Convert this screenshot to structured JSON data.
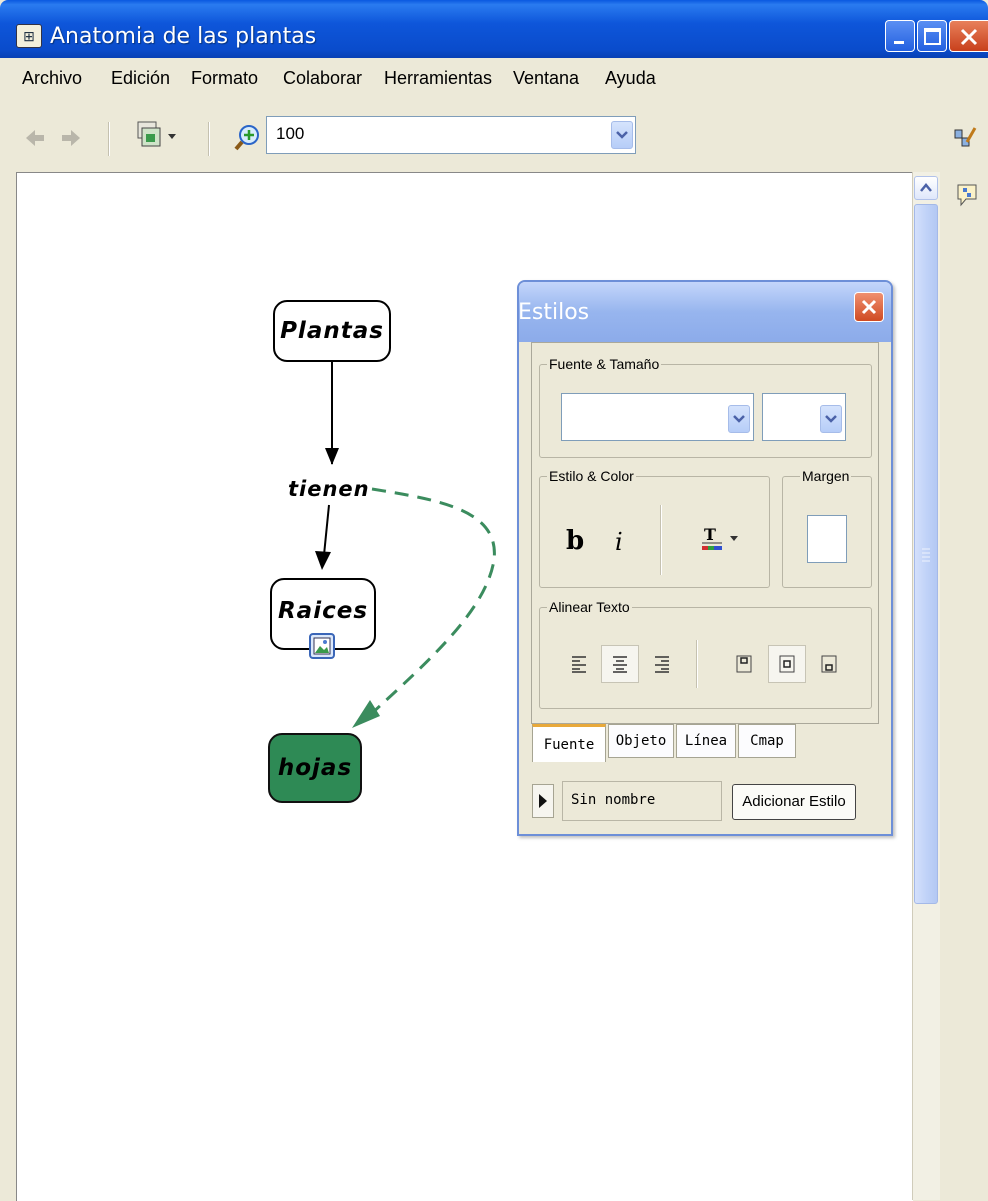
{
  "window": {
    "title": "Anatomia de las plantas"
  },
  "menu": [
    "Archivo",
    "Edición",
    "Formato",
    "Colaborar",
    "Herramientas",
    "Ventana",
    "Ayuda"
  ],
  "toolbar": {
    "zoom_value": "100"
  },
  "concept_map": {
    "nodes": {
      "plantas": "Plantas",
      "raices": "Raices",
      "hojas": "hojas"
    },
    "linking_phrase": "tienen",
    "colors": {
      "hojas_fill": "#2e8a55",
      "dashed_link": "#3b8c5e"
    }
  },
  "styles_dialog": {
    "title": "Estilos",
    "font_size_group": "Fuente & Tamaño",
    "style_color_group": "Estilo & Color",
    "bold_label": "b",
    "italic_label": "i",
    "margin_group": "Margen",
    "align_group": "Alinear Texto",
    "tabs": [
      "Fuente",
      "Objeto",
      "Línea",
      "Cmap"
    ],
    "style_name": "Sin nombre",
    "add_style_button": "Adicionar Estilo"
  }
}
